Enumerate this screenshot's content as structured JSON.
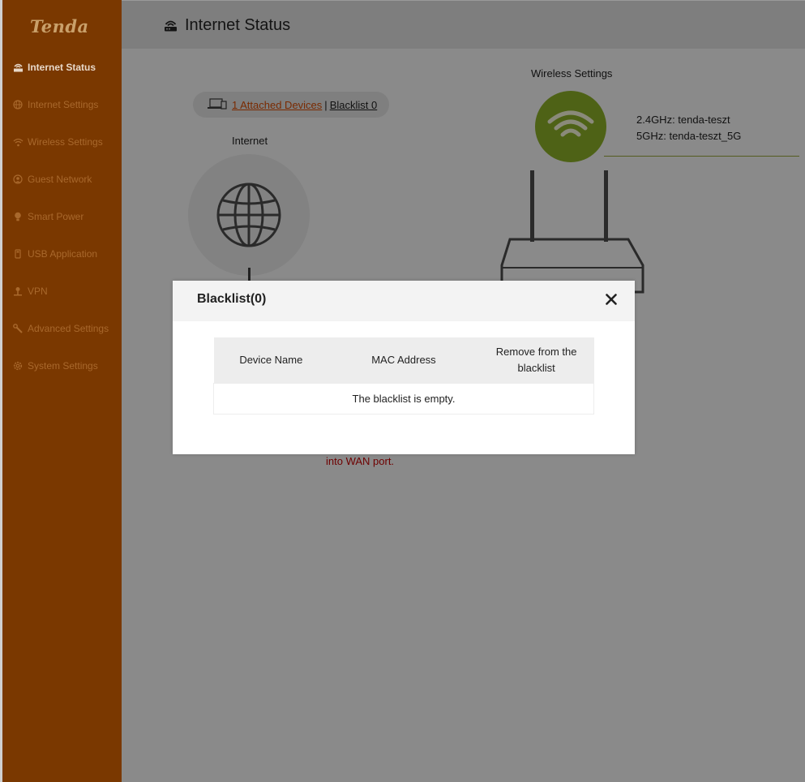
{
  "brand": {
    "logo_text": "Tenda"
  },
  "sidebar": {
    "items": [
      {
        "label": "Internet Status",
        "icon": "internet-status-icon",
        "active": true
      },
      {
        "label": "Internet Settings",
        "icon": "globe-icon"
      },
      {
        "label": "Wireless Settings",
        "icon": "wifi-icon"
      },
      {
        "label": "Guest Network",
        "icon": "guest-icon"
      },
      {
        "label": "Smart Power",
        "icon": "bulb-icon"
      },
      {
        "label": "USB Application",
        "icon": "usb-icon"
      },
      {
        "label": "VPN",
        "icon": "vpn-icon"
      },
      {
        "label": "Advanced Settings",
        "icon": "wrench-icon"
      },
      {
        "label": "System Settings",
        "icon": "gear-icon"
      }
    ]
  },
  "header": {
    "title": "Internet Status"
  },
  "status": {
    "attached_devices": "1 Attached Devices",
    "separator": "|",
    "blacklist_link": "Blacklist 0",
    "internet_label": "Internet",
    "wireless_label": "Wireless Settings",
    "ssid_24": "2.4GHz: tenda-teszt",
    "ssid_5": "5GHz: tenda-teszt_5G",
    "wan_message": "into WAN port."
  },
  "modal": {
    "title": "Blacklist(0)",
    "columns": [
      "Device Name",
      "MAC Address",
      "Remove from the blacklist"
    ],
    "empty_text": "The blacklist is empty."
  },
  "colors": {
    "sidebar_bg": "#7a3800",
    "accent_orange": "#d97817",
    "wifi_green": "#8db33a",
    "wan_red": "#cc0000"
  }
}
